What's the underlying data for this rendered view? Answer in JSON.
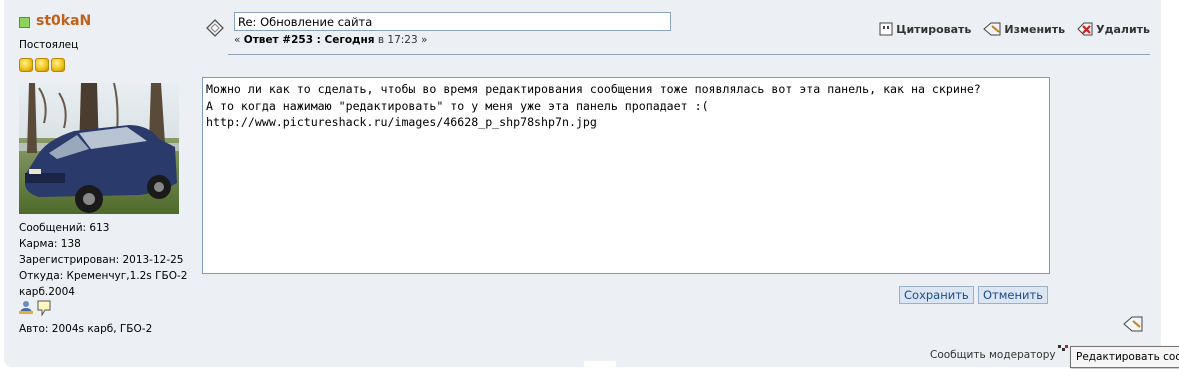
{
  "user": {
    "name": "st0kaN",
    "rank": "Постоялец",
    "stats": [
      "Сообщений: 613",
      "Карма: 138",
      "Зарегистрирован: 2013-12-25",
      "Откуда: Кременчуг,1.2s ГБО-2 карб.2004"
    ],
    "car": "Авто: 2004s карб, ГБО-2"
  },
  "post": {
    "subject": "Re: Обновление сайта",
    "meta_prefix": "«",
    "meta_answer": "Ответ #253 : Сегодня",
    "meta_time": " в 17:23 »",
    "body": "Можно ли как то сделать, чтобы во время редактирования сообщения тоже появлялась вот эта панель, как на скрине?\nА то когда нажимаю \"редактировать\" то у меня уже эта панель пропадает :(\nhttp://www.pictureshack.ru/images/46628_p_shp78shp7n.jpg"
  },
  "actions": {
    "quote": "Цитировать",
    "edit": "Изменить",
    "delete": "Удалить"
  },
  "buttons": {
    "save": "Сохранить",
    "cancel": "Отменить"
  },
  "footer": {
    "report": "Сообщить модератору",
    "tooltip": "Редактировать соо"
  },
  "colors": {
    "background": "#ecf0f4",
    "username": "#c0601a",
    "button_bg": "#dbe6f2",
    "button_text": "#1a4a8a"
  }
}
